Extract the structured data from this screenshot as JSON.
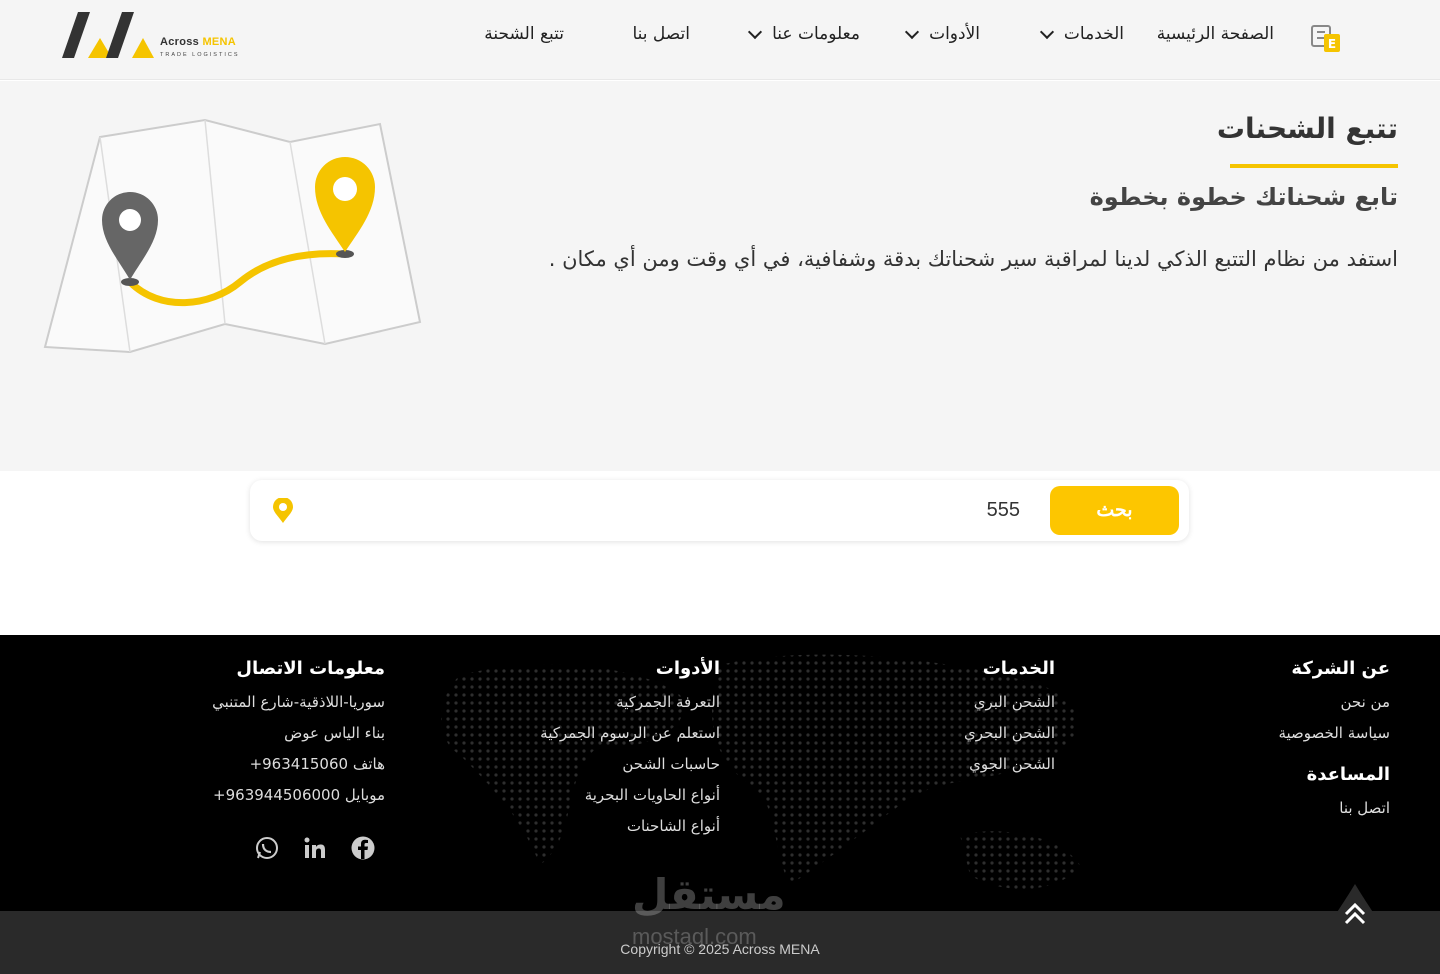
{
  "brand": {
    "name_a": "Across ",
    "name_b": "MENA",
    "tagline": "TRADE LOGISTICS"
  },
  "nav": {
    "home": "الصفحة الرئيسية",
    "services": "الخدمات",
    "tools": "الأدوات",
    "about": "معلومات عنا",
    "contact": "اتصل بنا",
    "track": "تتبع الشحنة"
  },
  "hero": {
    "title": "تتبع الشحنات",
    "subtitle": "تابع شحناتك خطوة بخطوة",
    "description": "استفد من نظام التتبع الذكي لدينا لمراقبة سير شحناتك بدقة وشفافية، في أي وقت ومن أي مكان ."
  },
  "search": {
    "button": "بحث",
    "value": "555"
  },
  "footer": {
    "company": {
      "title": "عن الشركة",
      "links": [
        "من نحن",
        "سياسة الخصوصية"
      ]
    },
    "help": {
      "title": "المساعدة",
      "links": [
        "اتصل بنا"
      ]
    },
    "services": {
      "title": "الخدمات",
      "links": [
        "الشحن البري",
        "الشحن البحري",
        "الشحن الجوي"
      ]
    },
    "tools": {
      "title": "الأدوات",
      "links": [
        "التعرفة الجمركية",
        "استعلم عن الرسوم الجمركية",
        "حاسبات الشحن",
        "أنواع الحاويات البحرية",
        "أنواع الشاحنات"
      ]
    },
    "contact": {
      "title": "معلومات الاتصال",
      "lines": [
        "سوريا-اللاذقية-شارع المتنبي",
        "بناء الياس عوض",
        "هاتف 963415060+",
        "موبايل 963944506000+"
      ]
    },
    "social_icons": [
      "whatsapp-icon",
      "linkedin-icon",
      "facebook-icon"
    ],
    "copyright": "Copyright © 2025 Across MENA"
  },
  "watermark": {
    "ar": "مستقل",
    "en": "mostaql.com"
  },
  "colors": {
    "accent": "#fdc600",
    "footer_bg": "#000000",
    "hero_bg": "#f5f5f5"
  }
}
